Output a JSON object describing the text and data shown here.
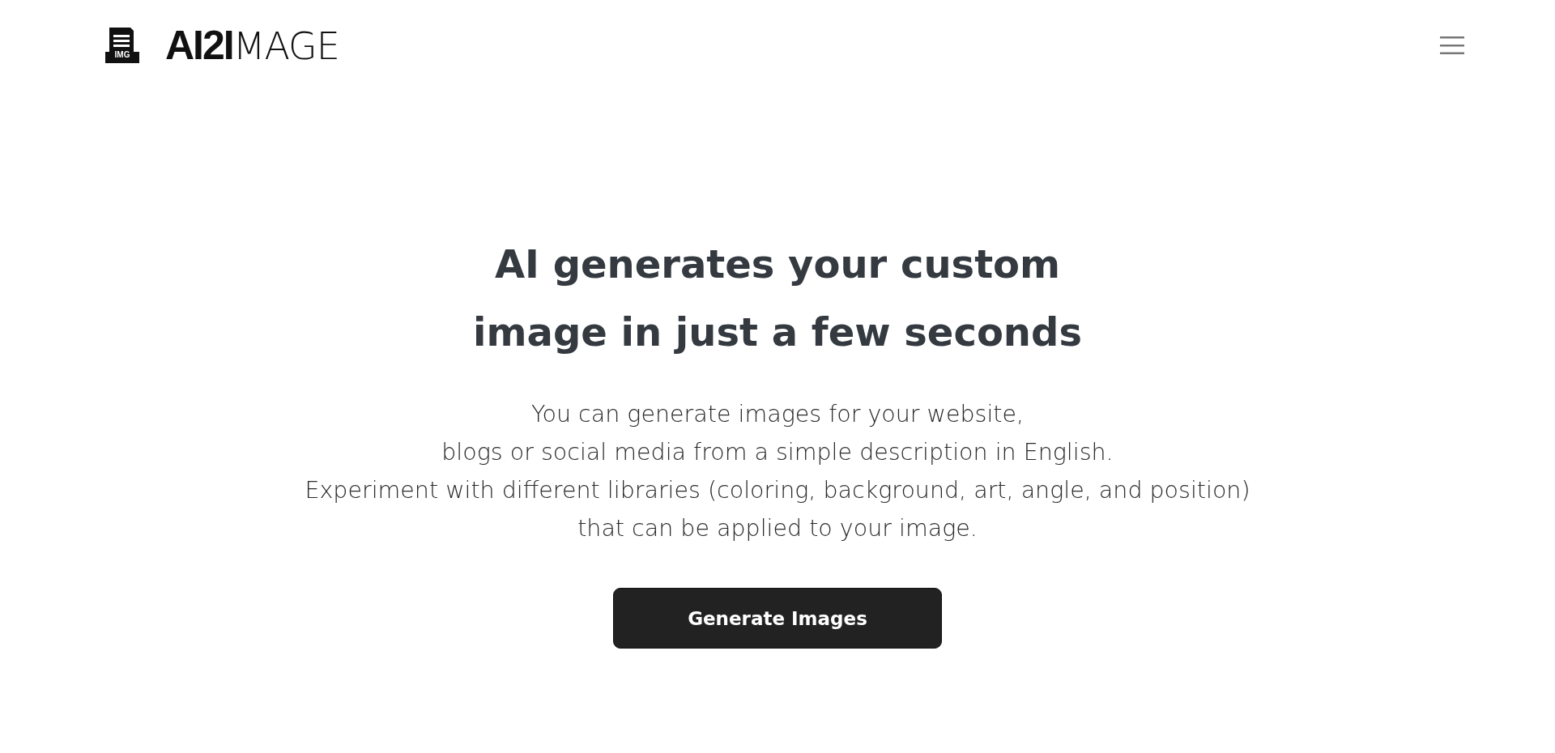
{
  "header": {
    "logo_badge": "IMG",
    "logo_text": "**AI2I**MAGE"
  },
  "hero": {
    "title_lines": [
      "AI generates your custom",
      "image in just a few seconds"
    ],
    "description_lines": [
      "You can generate images for your website,",
      "blogs or social media from a simple description in English.",
      "Experiment with different libraries (coloring, background, art, angle, and position)",
      "that can be applied to your image."
    ],
    "button": "Generate Images"
  }
}
